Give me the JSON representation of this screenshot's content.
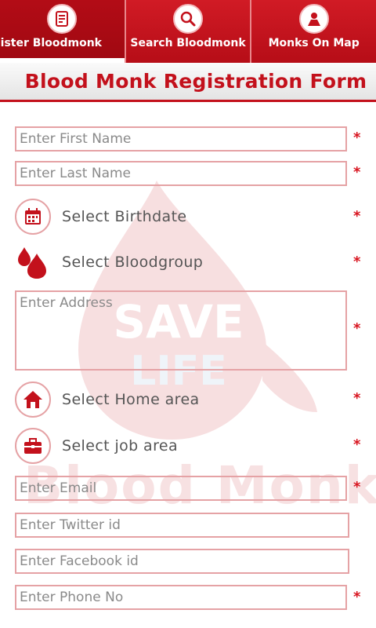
{
  "tabs": [
    {
      "label": "gister Bloodmonk",
      "icon": "register-icon",
      "active": true
    },
    {
      "label": "Search Bloodmonk",
      "icon": "search-icon",
      "active": false
    },
    {
      "label": "Monks On Map",
      "icon": "map-icon",
      "active": false
    }
  ],
  "header": {
    "title": "Blood Monk Registration Form"
  },
  "watermark": {
    "line1": "SAVE",
    "line2": "LIFE",
    "brand": "Blood Monk"
  },
  "form": {
    "first_name": {
      "placeholder": "Enter First Name",
      "required": "*"
    },
    "last_name": {
      "placeholder": "Enter Last Name",
      "required": "*"
    },
    "birthdate": {
      "label": "Select Birthdate",
      "icon": "calendar-icon",
      "required": "*"
    },
    "bloodgroup": {
      "label": "Select Bloodgroup",
      "icon": "blood-drop-icon",
      "required": "*"
    },
    "address": {
      "placeholder": "Enter Address",
      "required": "*"
    },
    "home_area": {
      "label": "Select Home area",
      "icon": "home-icon",
      "required": "*"
    },
    "job_area": {
      "label": "Select job area",
      "icon": "briefcase-icon",
      "required": "*"
    },
    "email": {
      "placeholder": "Enter Email",
      "required": "*"
    },
    "twitter": {
      "placeholder": "Enter Twitter id"
    },
    "facebook": {
      "placeholder": "Enter Facebook id"
    },
    "phone": {
      "placeholder": "Enter Phone No",
      "required": "*"
    }
  },
  "colors": {
    "brand_red": "#c3111c",
    "field_border": "#e5a2a5",
    "required": "#d8141f"
  }
}
